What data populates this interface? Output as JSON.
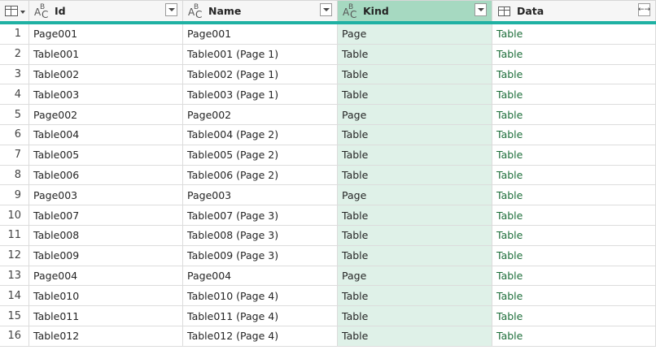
{
  "columns": [
    {
      "name": "Id",
      "type_icon": "abc-text-type-icon"
    },
    {
      "name": "Name",
      "type_icon": "abc-text-type-icon"
    },
    {
      "name": "Kind",
      "type_icon": "abc-text-type-icon"
    },
    {
      "name": "Data",
      "type_icon": "table-type-icon"
    }
  ],
  "accent_color": "#1fb1a3",
  "selected_column": "Kind",
  "rows": [
    {
      "n": "1",
      "id": "Page001",
      "name": "Page001",
      "kind": "Page",
      "data": "Table"
    },
    {
      "n": "2",
      "id": "Table001",
      "name": "Table001 (Page 1)",
      "kind": "Table",
      "data": "Table"
    },
    {
      "n": "3",
      "id": "Table002",
      "name": "Table002 (Page 1)",
      "kind": "Table",
      "data": "Table"
    },
    {
      "n": "4",
      "id": "Table003",
      "name": "Table003 (Page 1)",
      "kind": "Table",
      "data": "Table"
    },
    {
      "n": "5",
      "id": "Page002",
      "name": "Page002",
      "kind": "Page",
      "data": "Table"
    },
    {
      "n": "6",
      "id": "Table004",
      "name": "Table004 (Page 2)",
      "kind": "Table",
      "data": "Table"
    },
    {
      "n": "7",
      "id": "Table005",
      "name": "Table005 (Page 2)",
      "kind": "Table",
      "data": "Table"
    },
    {
      "n": "8",
      "id": "Table006",
      "name": "Table006 (Page 2)",
      "kind": "Table",
      "data": "Table"
    },
    {
      "n": "9",
      "id": "Page003",
      "name": "Page003",
      "kind": "Page",
      "data": "Table"
    },
    {
      "n": "10",
      "id": "Table007",
      "name": "Table007 (Page 3)",
      "kind": "Table",
      "data": "Table"
    },
    {
      "n": "11",
      "id": "Table008",
      "name": "Table008 (Page 3)",
      "kind": "Table",
      "data": "Table"
    },
    {
      "n": "12",
      "id": "Table009",
      "name": "Table009 (Page 3)",
      "kind": "Table",
      "data": "Table"
    },
    {
      "n": "13",
      "id": "Page004",
      "name": "Page004",
      "kind": "Page",
      "data": "Table"
    },
    {
      "n": "14",
      "id": "Table010",
      "name": "Table010 (Page 4)",
      "kind": "Table",
      "data": "Table"
    },
    {
      "n": "15",
      "id": "Table011",
      "name": "Table011 (Page 4)",
      "kind": "Table",
      "data": "Table"
    },
    {
      "n": "16",
      "id": "Table012",
      "name": "Table012 (Page 4)",
      "kind": "Table",
      "data": "Table"
    }
  ]
}
